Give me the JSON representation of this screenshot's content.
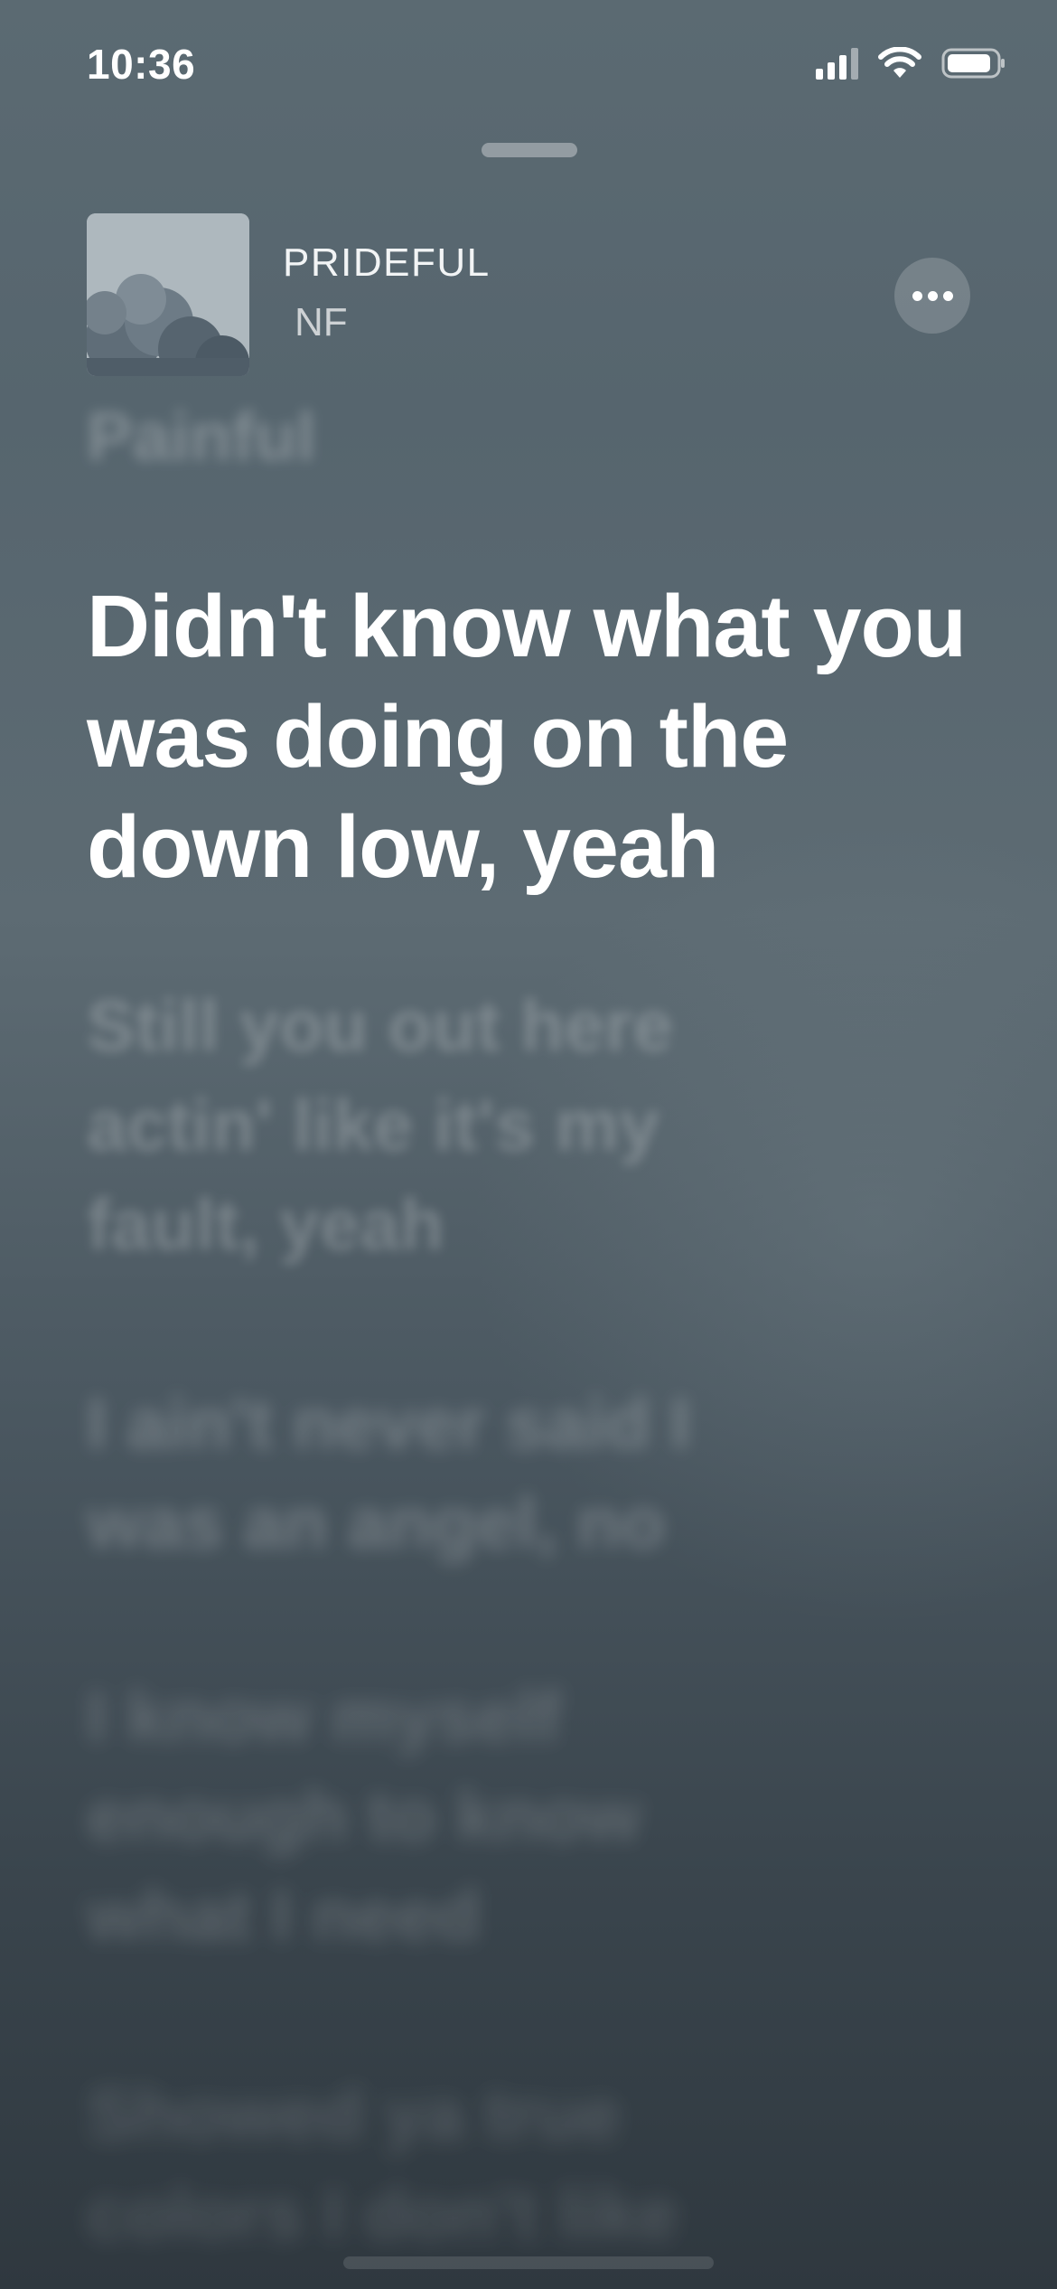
{
  "status_bar": {
    "time": "10:36",
    "icons": [
      "cellular-signal-icon",
      "wifi-icon",
      "battery-icon"
    ]
  },
  "now_playing": {
    "title": "PRIDEFUL",
    "artist": "NF",
    "artwork_icon": "cloud-artwork",
    "more_icon": "ellipsis-icon"
  },
  "lyrics": {
    "previous": "Painful",
    "current": "Didn't know what you was doing on the down low, yeah",
    "upcoming": [
      "Still you out here actin' like it's my fault, yeah",
      "I ain't never said I was an angel, no",
      "I know myself enough to know what I need",
      "Showed ya true colors I don't like"
    ]
  },
  "colors": {
    "background_top": "#5b6a72",
    "background_bottom": "#2f383f",
    "text_active": "#ffffff"
  }
}
